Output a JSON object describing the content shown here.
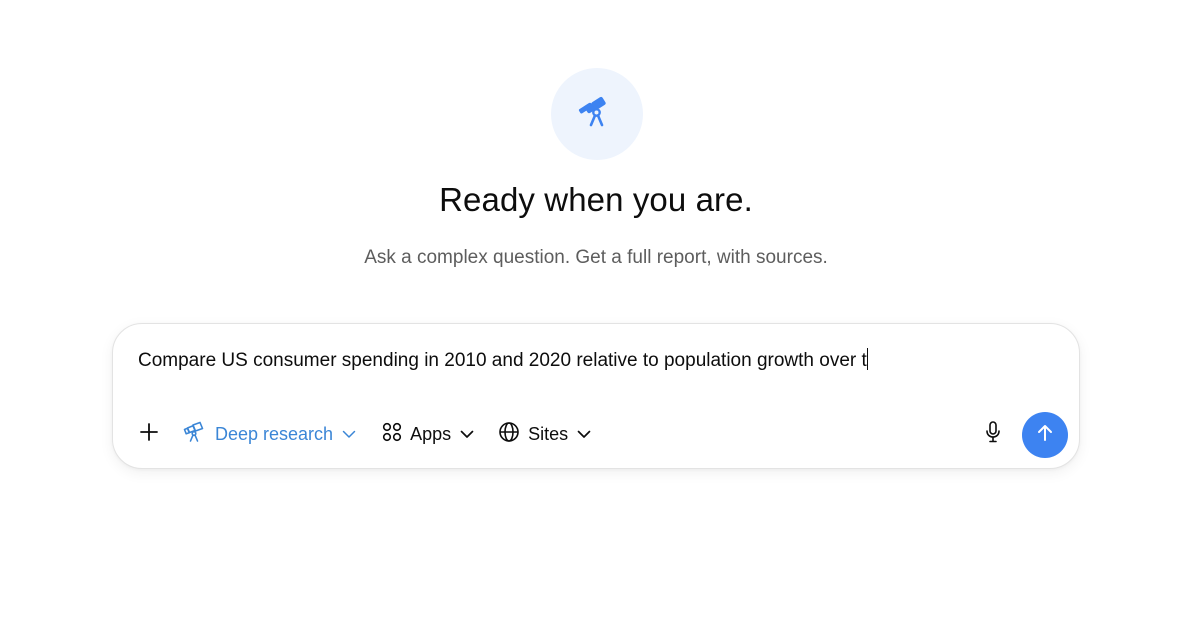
{
  "hero": {
    "title": "Ready when you are.",
    "subtitle": "Ask a complex question. Get a full report, with sources.",
    "icon": "telescope-icon",
    "badge_bg": "#eef4fd",
    "icon_color": "#3d83f1"
  },
  "composer": {
    "input_value": "Compare US consumer spending in 2010 and 2020 relative to population growth over t",
    "toolbar": {
      "add_icon": "plus-icon",
      "deep_research_label": "Deep research",
      "deep_research_icon": "telescope-icon",
      "apps_label": "Apps",
      "apps_icon": "apps-grid-icon",
      "sites_label": "Sites",
      "sites_icon": "globe-icon"
    },
    "mic_icon": "microphone-icon",
    "send_icon": "arrow-up-icon",
    "accent_color": "#3d83f1",
    "deep_research_color": "#3b86d6"
  }
}
